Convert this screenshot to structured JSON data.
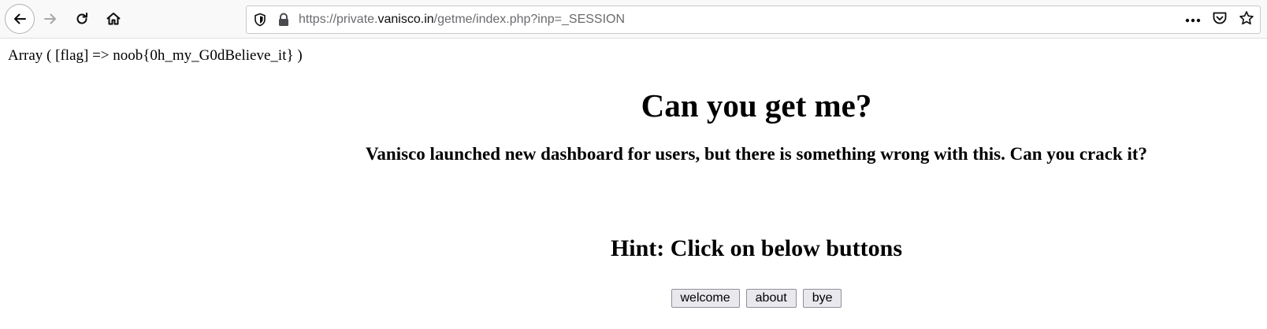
{
  "browser": {
    "url": {
      "prefix": "https://private.",
      "domain": "vanisco.in",
      "suffix": "/getme/index.php?inp=_SESSION"
    },
    "icons": {
      "back": "arrow-left-icon",
      "forward": "arrow-right-icon",
      "reload": "reload-icon",
      "home": "home-icon",
      "tracking": "shield-icon",
      "secure": "lock-icon",
      "page_actions": "more-dots-icon",
      "pocket": "pocket-icon",
      "bookmark": "star-icon"
    }
  },
  "page": {
    "dump": "Array ( [flag] => noob{0h_my_G0dBelieve_it} )",
    "title": "Can you get me?",
    "subtitle": "Vanisco launched new dashboard for users, but there is something wrong with this. Can you crack it?",
    "hint": "Hint: Click on below buttons",
    "buttons": [
      "welcome",
      "about",
      "bye"
    ]
  }
}
